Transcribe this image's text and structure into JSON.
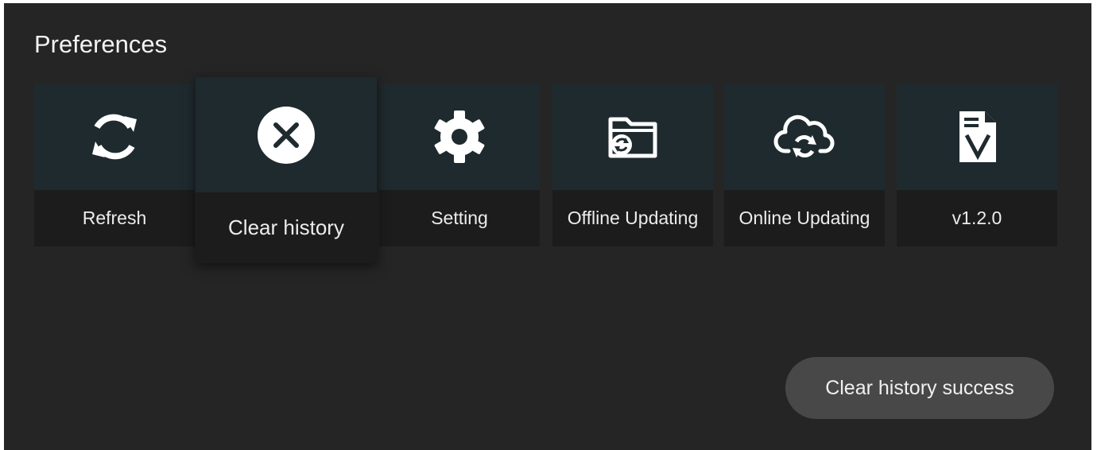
{
  "page": {
    "title": "Preferences"
  },
  "tiles": [
    {
      "label": "Refresh",
      "icon": "refresh-icon"
    },
    {
      "label": "Clear history",
      "icon": "close-circle-icon",
      "focused": true
    },
    {
      "label": "Setting",
      "icon": "gear-icon"
    },
    {
      "label": "Offline Updating",
      "icon": "folder-sync-icon"
    },
    {
      "label": "Online Updating",
      "icon": "cloud-sync-icon"
    },
    {
      "label": "v1.2.0",
      "icon": "version-document-icon"
    }
  ],
  "toast": {
    "message": "Clear history success"
  },
  "colors": {
    "background": "#252525",
    "tile_icon_bg": "#1f2a2f",
    "tile_label_bg": "#1c1c1c",
    "toast_bg": "#484848",
    "text": "#f2f2f2"
  }
}
